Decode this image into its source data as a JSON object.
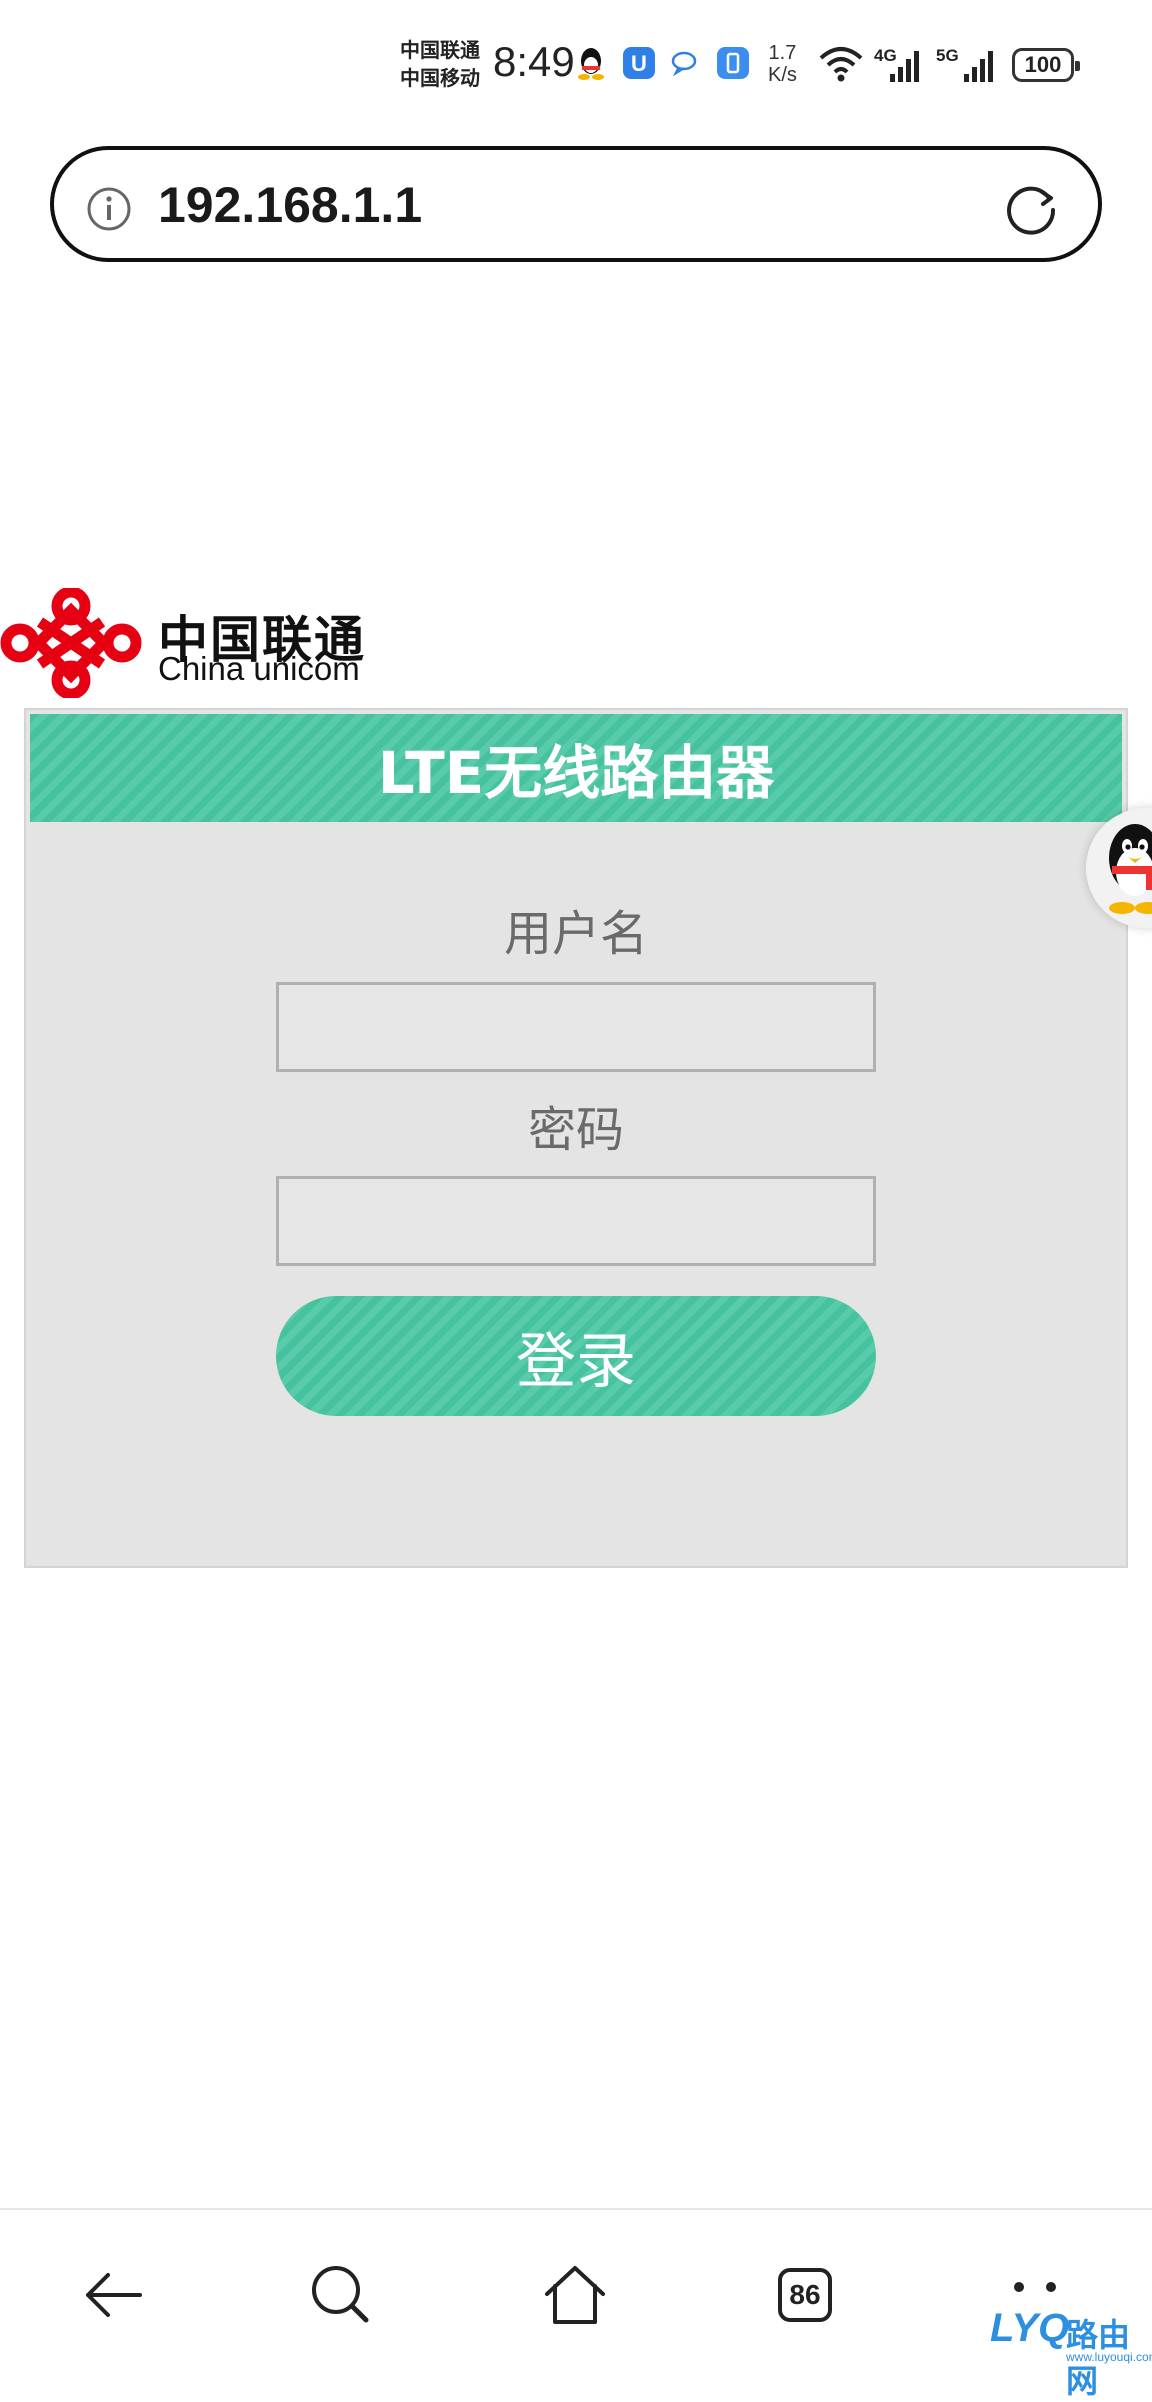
{
  "status_bar": {
    "carrier_1": "中国联通",
    "carrier_2": "中国移动",
    "time": "8:49",
    "speed_value": "1.7",
    "speed_unit": "K/s",
    "net_1": "4G",
    "net_2": "5G",
    "battery": "100",
    "icons": [
      "qq-icon",
      "u-app-icon",
      "chat-bubble-icon",
      "battery-app-icon",
      "wifi-icon",
      "signal-icon"
    ]
  },
  "address_bar": {
    "url": "192.168.1.1",
    "left_icon": "info-icon",
    "right_icon": "reload-icon"
  },
  "logo": {
    "name_cn": "中国联通",
    "name_en": "China unicom"
  },
  "login": {
    "title": "LTE无线路由器",
    "username_label": "用户名",
    "username_value": "",
    "password_label": "密码",
    "password_value": "",
    "submit_label": "登录"
  },
  "bottom_nav": {
    "items": [
      "back-icon",
      "search-icon",
      "home-icon",
      "tabs-icon",
      "menu-icon"
    ],
    "tab_count": "86"
  },
  "watermark": {
    "brand": "LYQ",
    "name": "路由网",
    "site": "www.luyouqi.com"
  },
  "colors": {
    "accent": "#47c29f",
    "panel_bg": "#e4e4e4",
    "unicom_red": "#e60012"
  }
}
